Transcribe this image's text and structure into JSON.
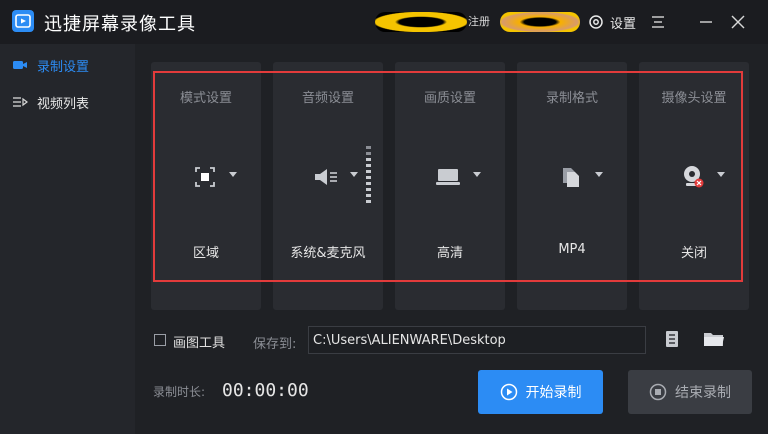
{
  "app": {
    "title": "迅捷屏幕录像工具"
  },
  "header": {
    "deco_text": "注册",
    "settings_label": "设置"
  },
  "sidebar": {
    "items": [
      {
        "label": "录制设置",
        "active": true
      },
      {
        "label": "视频列表",
        "active": false
      }
    ]
  },
  "settings_cards": [
    {
      "title": "模式设置",
      "value": "区域",
      "icon": "region-select-icon"
    },
    {
      "title": "音频设置",
      "value": "系统&麦克风",
      "icon": "speaker-icon"
    },
    {
      "title": "画质设置",
      "value": "高清",
      "icon": "monitor-icon"
    },
    {
      "title": "录制格式",
      "value": "MP4",
      "icon": "file-copy-icon"
    },
    {
      "title": "摄像头设置",
      "value": "关闭",
      "icon": "webcam-off-icon"
    }
  ],
  "drawing_tool": {
    "label": "画图工具",
    "checked": false
  },
  "save": {
    "label": "保存到:",
    "path": "C:\\Users\\ALIENWARE\\Desktop"
  },
  "duration": {
    "label": "录制时长:",
    "value": "00:00:00"
  },
  "buttons": {
    "start": "开始录制",
    "stop": "结束录制"
  },
  "colors": {
    "accent": "#2c8cf4",
    "background": "#1f2125",
    "sidebar": "#24262b",
    "card": "#2a2c31",
    "highlight": "#e23b3b"
  }
}
